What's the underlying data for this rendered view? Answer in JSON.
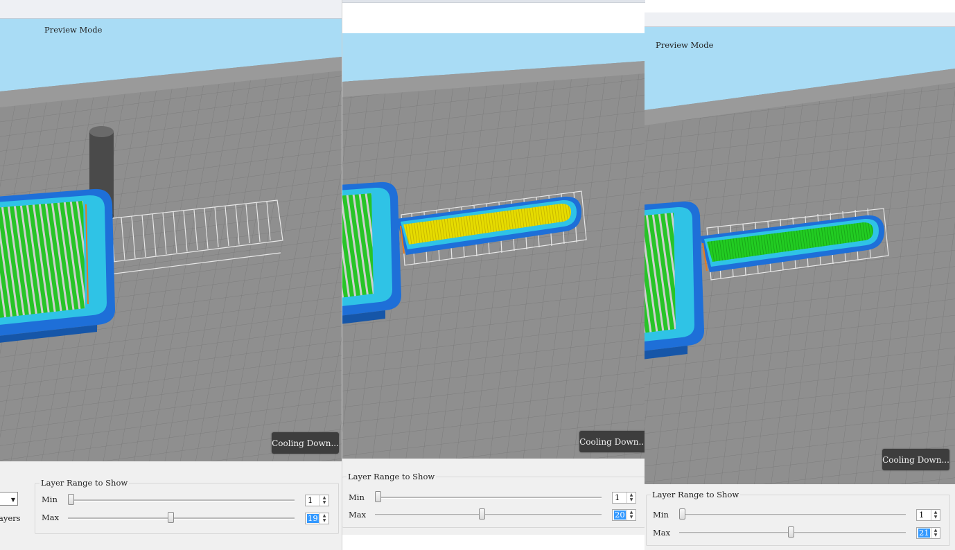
{
  "panels": [
    {
      "mode_label": "Preview Mode",
      "toast": "Cooling Down...",
      "layer_range": {
        "title": "Layer Range to Show",
        "min_label": "Min",
        "max_label": "Max",
        "min_value": "1",
        "max_value": "19",
        "min_fraction": 0.0,
        "max_fraction": 0.44
      },
      "layers_label": "ayers"
    },
    {
      "toast": "Cooling Down...",
      "layer_range": {
        "title": "Layer Range to Show",
        "min_label": "Min",
        "max_label": "Max",
        "min_value": "1",
        "max_value": "20",
        "min_fraction": 0.0,
        "max_fraction": 0.46
      }
    },
    {
      "mode_label": "Preview Mode",
      "toast": "Cooling Down...",
      "layer_range": {
        "title": "Layer Range to Show",
        "min_label": "Min",
        "max_label": "Max",
        "min_value": "1",
        "max_value": "21",
        "min_fraction": 0.0,
        "max_fraction": 0.48
      }
    }
  ],
  "colors": {
    "sky": "#a9dcf5",
    "bed": "#8f8f8f",
    "wall_outer": "#1e6fd8",
    "wall_inner": "#2fc3e6",
    "infill_green": "#22cc22",
    "infill_yellow": "#e6dc00",
    "toast_bg": "#3d3d3d",
    "selection": "#3399ff"
  },
  "icons": [
    "spin-up-icon",
    "spin-down-icon",
    "dropdown-arrow-icon"
  ]
}
